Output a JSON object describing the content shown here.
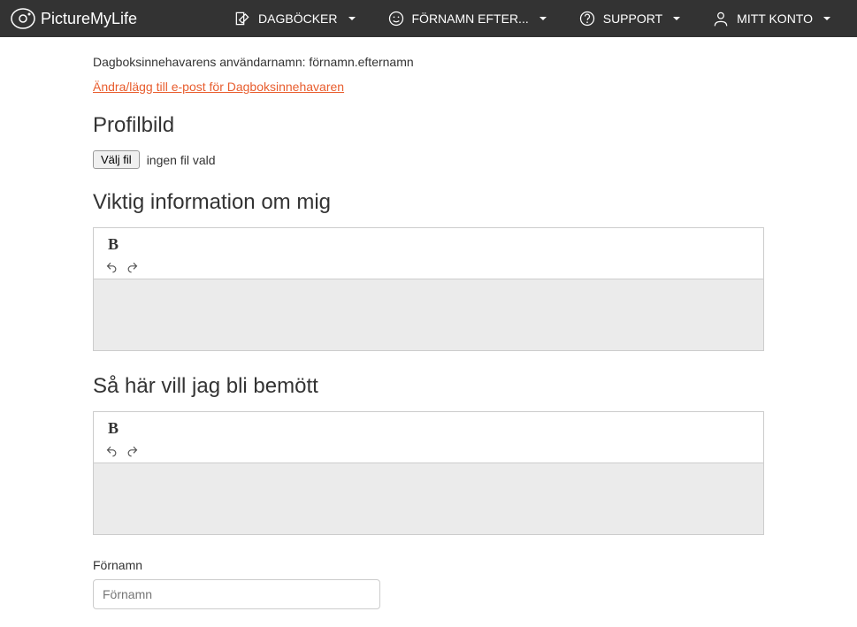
{
  "logo_text": "PictureMyLife",
  "nav": {
    "diaries": "DAGBÖCKER",
    "name": "FÖRNAMN EFTER...",
    "support": "SUPPORT",
    "account": "MITT KONTO"
  },
  "owner_label": "Dagboksinnehavarens användarnamn: förnamn.efternamn",
  "email_link": "Ändra/lägg till e-post för Dagboksinnehavaren",
  "profile_heading": "Profilbild",
  "file_button": "Välj fil",
  "file_none": "ingen fil vald",
  "important_heading": "Viktig information om mig",
  "treatment_heading": "Så här vill jag bli bemött",
  "firstname_label": "Förnamn",
  "firstname_placeholder": "Förnamn",
  "bold_label": "B"
}
